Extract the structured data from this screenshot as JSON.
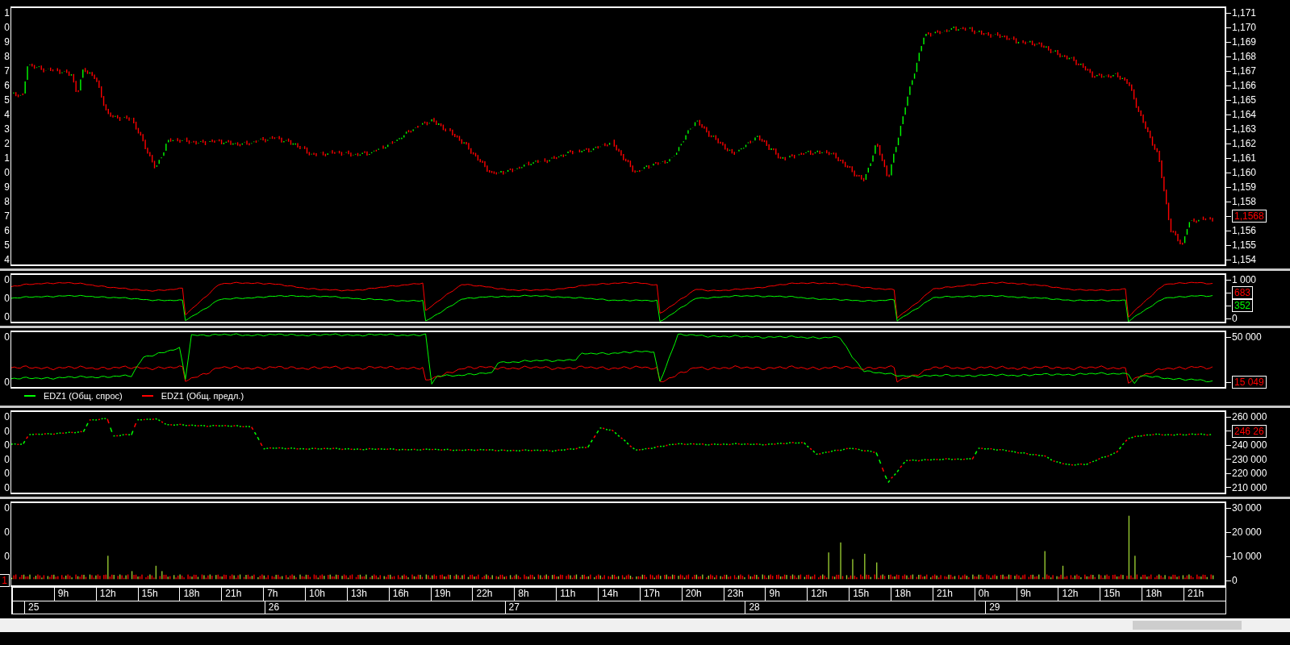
{
  "price_chart": {
    "left_axis": [
      {
        "kind": "tick",
        "label": "1"
      },
      {
        "kind": "tick",
        "label": "0"
      },
      {
        "kind": "tick",
        "label": "9"
      },
      {
        "kind": "tick",
        "label": "8"
      },
      {
        "kind": "tick",
        "label": "7"
      },
      {
        "kind": "tick",
        "label": "6"
      },
      {
        "kind": "tick",
        "label": "5"
      },
      {
        "kind": "tick",
        "label": "4"
      },
      {
        "kind": "tick",
        "label": "3"
      },
      {
        "kind": "tick",
        "label": "2"
      },
      {
        "kind": "tick",
        "label": "1"
      },
      {
        "kind": "tick",
        "label": "0"
      },
      {
        "kind": "tick",
        "label": "9"
      },
      {
        "kind": "tick",
        "label": "8"
      },
      {
        "kind": "tick",
        "label": "7"
      },
      {
        "kind": "tick",
        "label": "6"
      },
      {
        "kind": "tick",
        "label": "5"
      },
      {
        "kind": "tick",
        "label": "4"
      }
    ],
    "right_axis": [
      {
        "kind": "tick",
        "label": "1,171"
      },
      {
        "kind": "tick",
        "label": "1,170"
      },
      {
        "kind": "tick",
        "label": "1,169"
      },
      {
        "kind": "tick",
        "label": "1,168"
      },
      {
        "kind": "tick",
        "label": "1,167"
      },
      {
        "kind": "tick",
        "label": "1,166"
      },
      {
        "kind": "tick",
        "label": "1,165"
      },
      {
        "kind": "tick",
        "label": "1,164"
      },
      {
        "kind": "tick",
        "label": "1,163"
      },
      {
        "kind": "tick",
        "label": "1,162"
      },
      {
        "kind": "tick",
        "label": "1,161"
      },
      {
        "kind": "tick",
        "label": "1,160"
      },
      {
        "kind": "tick",
        "label": "1,159"
      },
      {
        "kind": "tick",
        "label": "1,158"
      },
      {
        "kind": "badge",
        "label": "1,1568",
        "color": "#ff0000"
      },
      {
        "kind": "tick",
        "label": "1,156"
      },
      {
        "kind": "tick",
        "label": "1,155"
      },
      {
        "kind": "tick",
        "label": "1,154"
      }
    ]
  },
  "panel_2": {
    "left_axis": [
      {
        "kind": "tick",
        "label": "0"
      },
      {
        "kind": "tick",
        "label": "0"
      },
      {
        "kind": "tick",
        "label": "0"
      }
    ],
    "right_axis": [
      {
        "kind": "tick",
        "label": "1 000"
      },
      {
        "kind": "badge",
        "label": "683",
        "color": "#ff0000"
      },
      {
        "kind": "badge",
        "label": "352",
        "color": "#00ff00"
      },
      {
        "kind": "tick",
        "label": "0"
      }
    ]
  },
  "orders_chart": {
    "left_axis": [
      {
        "kind": "tick",
        "label": "0"
      },
      {
        "kind": "tick",
        "label": "0"
      }
    ],
    "right_axis": [
      {
        "kind": "tick",
        "label": "50 000"
      },
      {
        "kind": "badge",
        "label": "15 049",
        "color": "#ff0000"
      }
    ],
    "legend": [
      {
        "label": "EDZ1 (Общ. спрос)",
        "color": "#00ff00"
      },
      {
        "label": "EDZ1 (Общ. предл.)",
        "color": "#ff0000"
      }
    ]
  },
  "panel_4": {
    "left_axis": [
      {
        "kind": "tick",
        "label": "0"
      },
      {
        "kind": "tick",
        "label": "0"
      },
      {
        "kind": "tick",
        "label": "0"
      },
      {
        "kind": "tick",
        "label": "0"
      },
      {
        "kind": "tick",
        "label": "0"
      },
      {
        "kind": "tick",
        "label": "0"
      }
    ],
    "right_axis": [
      {
        "kind": "tick",
        "label": "260 000"
      },
      {
        "kind": "badge",
        "label": "246 26",
        "color": "#ff0000"
      },
      {
        "kind": "tick",
        "label": "240 000"
      },
      {
        "kind": "tick",
        "label": "230 000"
      },
      {
        "kind": "tick",
        "label": "220 000"
      },
      {
        "kind": "tick",
        "label": "210 000"
      }
    ]
  },
  "volume_chart": {
    "left_axis": [
      {
        "kind": "tick",
        "label": "0"
      },
      {
        "kind": "tick",
        "label": "0"
      },
      {
        "kind": "tick",
        "label": "0"
      },
      {
        "kind": "badge",
        "label": "1",
        "color": "#ff0000"
      }
    ],
    "right_axis": [
      {
        "kind": "tick",
        "label": "30 000"
      },
      {
        "kind": "tick",
        "label": "20 000"
      },
      {
        "kind": "tick",
        "label": "10 000"
      },
      {
        "kind": "tick",
        "label": "0"
      }
    ]
  },
  "time_axis": {
    "hours": [
      "9h",
      "12h",
      "15h",
      "18h",
      "21h",
      "7h",
      "10h",
      "13h",
      "16h",
      "19h",
      "22h",
      "8h",
      "11h",
      "14h",
      "17h",
      "20h",
      "23h",
      "9h",
      "12h",
      "15h",
      "18h",
      "21h",
      "0h",
      "9h",
      "12h",
      "15h",
      "18h",
      "21h"
    ],
    "dates": [
      "25",
      "26",
      "27",
      "28",
      "29"
    ]
  }
}
